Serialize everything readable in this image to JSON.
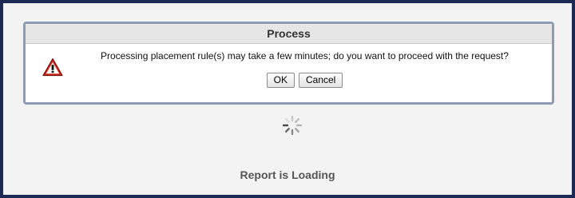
{
  "dialog": {
    "title": "Process",
    "message": "Processing placement rule(s) may take a few minutes; do you want to proceed with the request?",
    "icon": "warning-icon",
    "ok_label": "OK",
    "cancel_label": "Cancel"
  },
  "loading": {
    "icon": "loading-spinner-icon",
    "text": "Report is Loading"
  },
  "colors": {
    "frame_border": "#1c2a55",
    "dialog_border": "#8d9bb5",
    "warning_red": "#d02a1e"
  }
}
